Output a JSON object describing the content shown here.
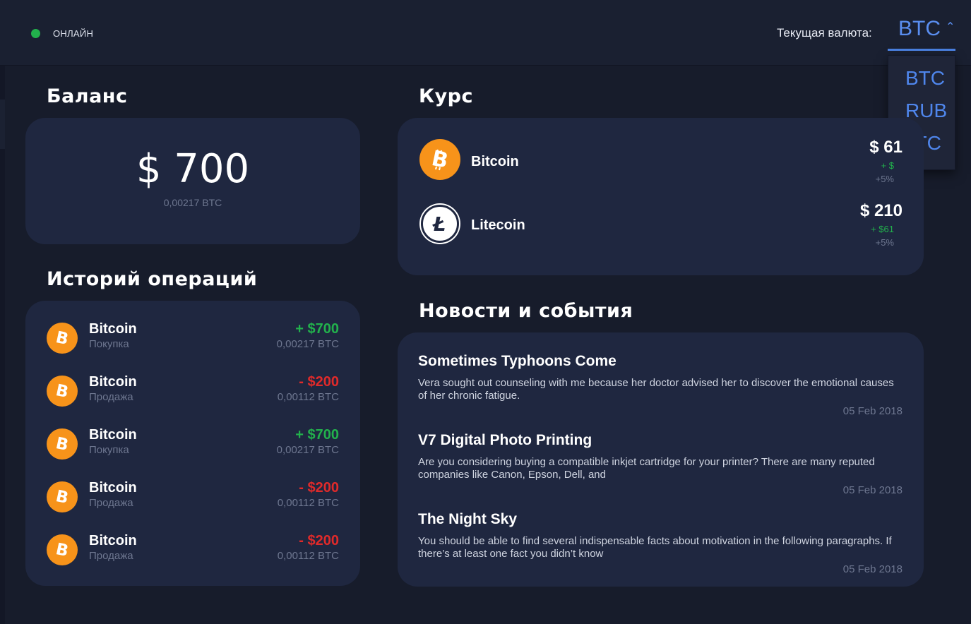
{
  "header": {
    "status_text": "ОНЛАЙН",
    "currency_label": "Текущая валюта:",
    "currency_selected": "BTC",
    "currency_options": [
      "BTC",
      "RUB",
      "LTC"
    ]
  },
  "balance": {
    "title": "Баланс",
    "amount": "$ 700",
    "btc": "0,00217 BTC"
  },
  "rates": {
    "title": "Курс",
    "items": [
      {
        "name": "Bitcoin",
        "price": "$ 61",
        "change": "+ $",
        "pct": "+5%",
        "icon": "bitcoin-icon"
      },
      {
        "name": "Litecoin",
        "price": "$ 210",
        "change": "+ $61",
        "pct": "+5%",
        "icon": "litecoin-icon"
      }
    ]
  },
  "history": {
    "title": "Историй операций",
    "items": [
      {
        "name": "Bitcoin",
        "type": "Покупка",
        "amount": "+ $700",
        "btc": "0,00217 BTC",
        "direction": "plus"
      },
      {
        "name": "Bitcoin",
        "type": "Продажа",
        "amount": "- $200",
        "btc": "0,00112 BTC",
        "direction": "minus"
      },
      {
        "name": "Bitcoin",
        "type": "Покупка",
        "amount": "+ $700",
        "btc": "0,00217 BTC",
        "direction": "plus"
      },
      {
        "name": "Bitcoin",
        "type": "Продажа",
        "amount": "- $200",
        "btc": "0,00112 BTC",
        "direction": "minus"
      },
      {
        "name": "Bitcoin",
        "type": "Продажа",
        "amount": "- $200",
        "btc": "0,00112 BTC",
        "direction": "minus"
      }
    ]
  },
  "news": {
    "title": "Новости и события",
    "items": [
      {
        "title": "Sometimes Typhoons Come",
        "text": "Vera sought out counseling with me because her doctor advised her to discover the emotional causes of her chronic fatigue.",
        "date": "05 Feb 2018"
      },
      {
        "title": "V7 Digital Photo Printing",
        "text": "Are you considering buying a compatible inkjet cartridge for your printer? There are many reputed companies like Canon, Epson, Dell, and",
        "date": "05 Feb 2018"
      },
      {
        "title": "The Night Sky",
        "text": "You should be able to find several indispensable facts about motivation in the following paragraphs. If there’s at least one fact you didn’t know",
        "date": "05 Feb 2018"
      }
    ]
  },
  "colors": {
    "background": "#171c2b",
    "card": "#1f2740",
    "accent": "#5a8ef0",
    "positive": "#22b14c",
    "negative": "#e02a2a",
    "bitcoin": "#f7931a"
  }
}
